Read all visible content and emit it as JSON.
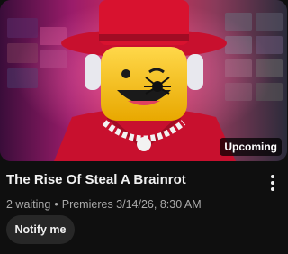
{
  "video": {
    "title": "The Rise Of Steal A Brainrot",
    "badge": "Upcoming",
    "waiting": "2 waiting",
    "separator": "•",
    "premiere": "Premieres 3/14/26, 8:30 AM"
  },
  "actions": {
    "notify_label": "Notify me",
    "more_icon": "vertical-ellipsis-icon"
  },
  "colors": {
    "background": "#0f0f0f",
    "title_text": "#f1f1f1",
    "meta_text": "#aaaaaa",
    "button_bg": "#272727"
  }
}
